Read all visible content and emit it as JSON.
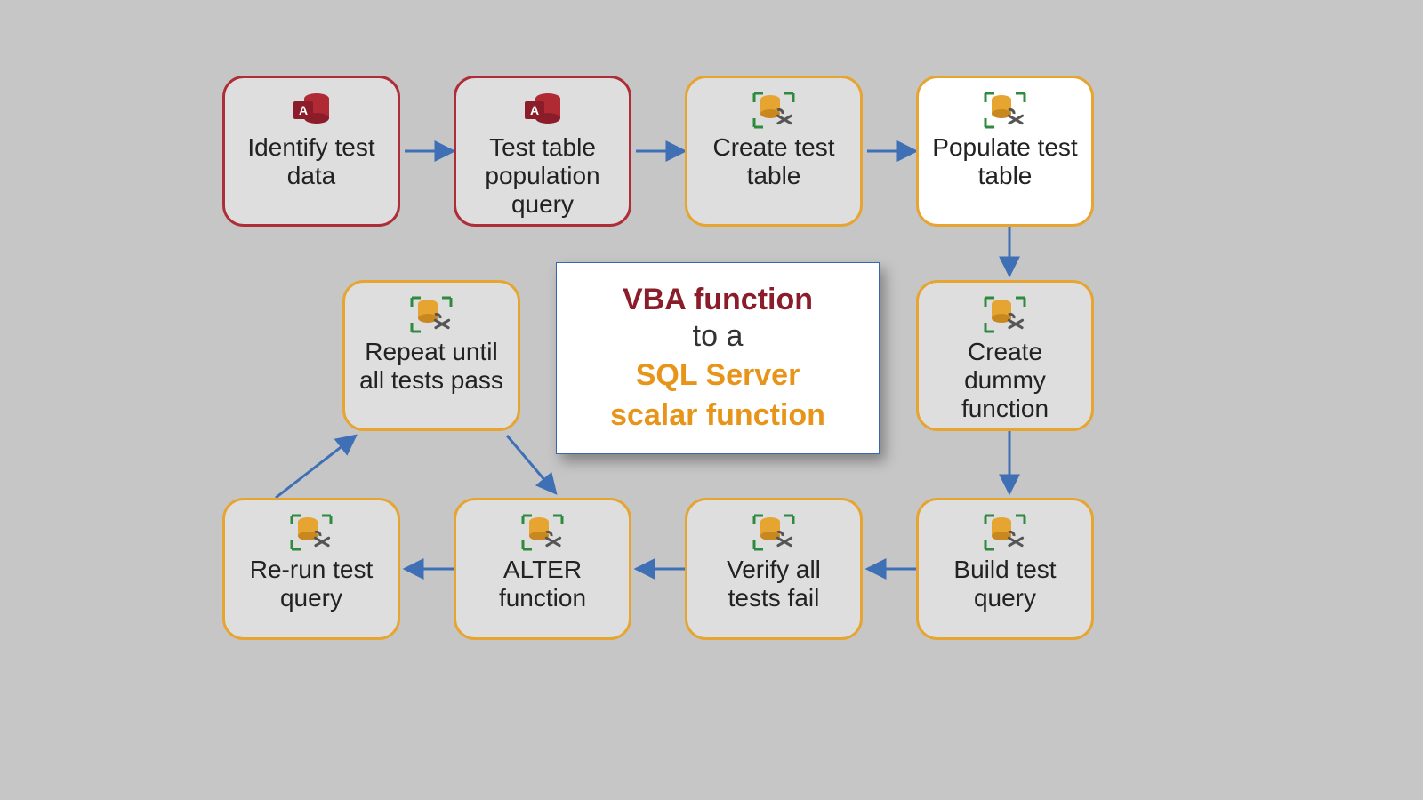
{
  "a": {
    "identify": "Identify test data",
    "popquery": "Test table population query",
    "createtbl": "Create test table",
    "poptbl": "Populate test table",
    "dummy": "Create dummy function",
    "buildq": "Build test query",
    "verifyfail": "Verify all tests fail",
    "alter": "ALTER function",
    "rerun": "Re-run test query",
    "repeat": "Repeat until all tests pass"
  },
  "center": {
    "vba": "VBA function",
    "toa": "to a",
    "sql1": "SQL Server",
    "sql2": "scalar function"
  },
  "colors": {
    "red_border": "#ad2e36",
    "gold_border": "#e6a530",
    "arrow": "#3f6fb5",
    "bg": "#c6c6c6"
  },
  "icons": {
    "access": "access-db-icon",
    "sql": "sql-tools-icon"
  },
  "diagram": {
    "purpose": "Process to convert a VBA function into a SQL Server scalar function",
    "steps_in_order": [
      "Identify test data",
      "Test table population query",
      "Create test table",
      "Populate test table",
      "Create dummy function",
      "Build test query",
      "Verify all tests fail",
      "ALTER function",
      "Re-run test query",
      "Repeat until all tests pass"
    ],
    "loop": [
      "Repeat until all tests pass",
      "ALTER function",
      "Re-run test query"
    ]
  }
}
